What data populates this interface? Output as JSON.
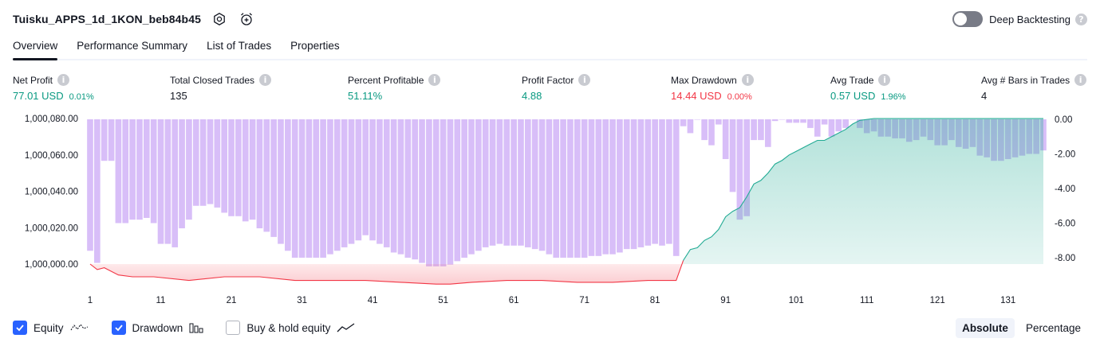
{
  "header": {
    "strategy_name": "Tuisku_APPS_1d_1KON_beb84b45",
    "deep_backtesting_label": "Deep Backtesting",
    "info_glyph": "?"
  },
  "tabs": [
    {
      "label": "Overview",
      "active": true
    },
    {
      "label": "Performance Summary",
      "active": false
    },
    {
      "label": "List of Trades",
      "active": false
    },
    {
      "label": "Properties",
      "active": false
    }
  ],
  "metrics": [
    {
      "label": "Net Profit",
      "value": "77.01 USD",
      "pct": "0.01%",
      "color": "green"
    },
    {
      "label": "Total Closed Trades",
      "value": "135",
      "pct": "",
      "color": "black"
    },
    {
      "label": "Percent Profitable",
      "value": "51.11%",
      "pct": "",
      "color": "green"
    },
    {
      "label": "Profit Factor",
      "value": "4.88",
      "pct": "",
      "color": "green"
    },
    {
      "label": "Max Drawdown",
      "value": "14.44 USD",
      "pct": "0.00%",
      "color": "red"
    },
    {
      "label": "Avg Trade",
      "value": "0.57 USD",
      "pct": "1.96%",
      "color": "green"
    },
    {
      "label": "Avg # Bars in Trades",
      "value": "4",
      "pct": "",
      "color": "black"
    }
  ],
  "legend": {
    "equity_label": "Equity",
    "drawdown_label": "Drawdown",
    "buy_hold_label": "Buy & hold equity",
    "equity_checked": true,
    "drawdown_checked": true,
    "buy_hold_checked": false
  },
  "modes": {
    "absolute_label": "Absolute",
    "percentage_label": "Percentage",
    "active": "Absolute"
  },
  "colors": {
    "green": "#089981",
    "red": "#f23645",
    "drawdown_bar": "#d1b3f7",
    "equity_up_line": "#22ab94",
    "equity_down_line": "#f23645",
    "checkbox": "#2962ff"
  },
  "chart_data": {
    "type": "area",
    "left_axis": {
      "ticks": [
        "1,000,080.00",
        "1,000,060.00",
        "1,000,040.00",
        "1,000,020.00",
        "1,000,000.00"
      ],
      "values": [
        1000080,
        1000060,
        1000040,
        1000020,
        1000000
      ],
      "range": [
        999990,
        1000080
      ]
    },
    "right_axis": {
      "ticks": [
        "0.00",
        "-2.00",
        "-4.00",
        "-6.00",
        "-8.00"
      ],
      "values": [
        0,
        -2,
        -4,
        -6,
        -8
      ],
      "range": [
        -8,
        0
      ]
    },
    "x_ticks": [
      "1",
      "11",
      "21",
      "31",
      "41",
      "51",
      "61",
      "71",
      "81",
      "91",
      "101",
      "111",
      "121",
      "131"
    ],
    "x_tick_values": [
      1,
      11,
      21,
      31,
      41,
      51,
      61,
      71,
      81,
      91,
      101,
      111,
      121,
      131
    ],
    "x_range": [
      1,
      136
    ],
    "equity": {
      "x": [
        1,
        2,
        3,
        5,
        7,
        10,
        15,
        20,
        25,
        30,
        35,
        40,
        45,
        50,
        52,
        55,
        60,
        65,
        70,
        75,
        80,
        84,
        85,
        86,
        87,
        88,
        89,
        90,
        91,
        92,
        93,
        94,
        95,
        96,
        97,
        98,
        99,
        100,
        101,
        102,
        103,
        104,
        105,
        106,
        107,
        108,
        109,
        110,
        112,
        115,
        120,
        125,
        130,
        136
      ],
      "values": [
        1000000,
        999997,
        999998,
        999994,
        999993,
        999993,
        999991,
        999993,
        999993,
        999991,
        999991,
        999991,
        999990,
        999989,
        999989,
        999990,
        999991,
        999991,
        999990,
        999990,
        999991,
        999991,
        1000002,
        1000008,
        1000009,
        1000013,
        1000015,
        1000019,
        1000026,
        1000029,
        1000031,
        1000037,
        1000044,
        1000046,
        1000050,
        1000055,
        1000057,
        1000060,
        1000062,
        1000064,
        1000066,
        1000068,
        1000068,
        1000070,
        1000072,
        1000074,
        1000077,
        1000079,
        1000080,
        1000080,
        1000080,
        1000080,
        1000080,
        1000080
      ]
    },
    "drawdown": {
      "x_start": 1,
      "values": [
        -7.6,
        -8.3,
        -2.4,
        -2.4,
        -6.0,
        -6.0,
        -5.8,
        -5.8,
        -5.7,
        -6.0,
        -7.2,
        -7.2,
        -7.4,
        -6.3,
        -5.8,
        -5.0,
        -5.0,
        -4.9,
        -5.1,
        -5.4,
        -5.6,
        -5.6,
        -5.9,
        -5.8,
        -6.3,
        -6.5,
        -6.8,
        -7.2,
        -7.6,
        -8.0,
        -8.0,
        -8.0,
        -8.0,
        -8.0,
        -7.8,
        -7.6,
        -7.4,
        -7.2,
        -7.0,
        -6.7,
        -7.0,
        -7.2,
        -7.4,
        -7.7,
        -7.8,
        -8.0,
        -8.1,
        -8.3,
        -8.5,
        -8.5,
        -8.5,
        -8.4,
        -8.2,
        -8.0,
        -7.8,
        -7.6,
        -7.4,
        -7.3,
        -7.2,
        -7.3,
        -7.3,
        -7.3,
        -7.4,
        -7.5,
        -7.6,
        -7.8,
        -8.0,
        -8.0,
        -8.0,
        -8.0,
        -8.0,
        -7.9,
        -7.9,
        -7.8,
        -7.8,
        -7.7,
        -7.5,
        -7.5,
        -7.4,
        -7.3,
        -7.2,
        -7.3,
        -7.2,
        -7.9,
        -0.4,
        -0.8,
        0.0,
        -1.2,
        -1.5,
        -0.3,
        -2.3,
        -4.2,
        -5.8,
        -5.6,
        -1.2,
        -1.2,
        -1.6,
        -0.1,
        0.0,
        -0.2,
        -0.2,
        -0.2,
        -0.5,
        -1.0,
        -0.3,
        -1.0,
        -0.7,
        -0.5,
        0.0,
        -0.5,
        -0.8,
        -0.7,
        -1.0,
        -1.0,
        -1.1,
        -1.1,
        -1.3,
        -1.2,
        -1.0,
        -1.2,
        -1.5,
        -1.5,
        -1.2,
        -1.6,
        -1.7,
        -1.6,
        -2.1,
        -2.2,
        -2.4,
        -2.4,
        -2.3,
        -2.2,
        -2.1,
        -2.0,
        -2.0,
        -1.8
      ]
    }
  }
}
